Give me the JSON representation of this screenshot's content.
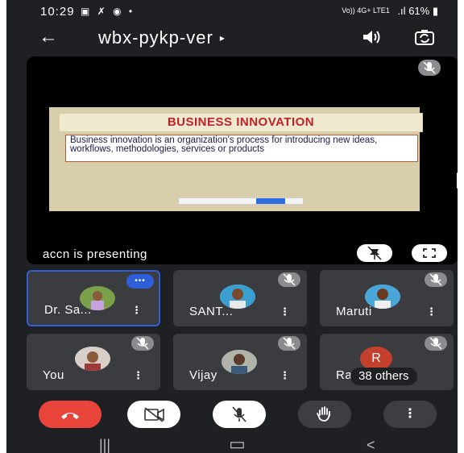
{
  "status_bar": {
    "time": "10:29",
    "notification_icons": [
      "gallery-icon",
      "missed-call-icon",
      "messenger-icon",
      "dot-icon"
    ],
    "network_label": "Vo)) 4G+ LTE1",
    "battery": "61%"
  },
  "header": {
    "meeting_title": "wbx-pykp-ver",
    "title_caret": "▸"
  },
  "presentation": {
    "slide_title": "BUSINESS INNOVATION",
    "slide_body": "Business innovation is an organization's process for introducing new ideas, workflows, methodologies, services or products",
    "presenter_label": "accn is presenting"
  },
  "participants": [
    {
      "name": "Dr. Sa...",
      "active_speaker": true,
      "muted": false
    },
    {
      "name": "SANT...",
      "active_speaker": false,
      "muted": true
    },
    {
      "name": "Maruti",
      "active_speaker": false,
      "muted": true
    },
    {
      "name": "You",
      "active_speaker": false,
      "muted": true
    },
    {
      "name": "Vijay",
      "active_speaker": false,
      "muted": true
    },
    {
      "name": "Ra",
      "avatar_initial": "R",
      "others_label": "38 others",
      "muted": true
    }
  ],
  "tile_more_glyph": "⋮",
  "speaker_badge_glyph": "•••",
  "controls": {
    "end_call": "end-call-icon",
    "video": "video-off-icon",
    "mic": "mic-off-icon",
    "hand": "raise-hand-icon",
    "more_glyph": "⋮"
  },
  "nav": {
    "recents": "|||",
    "home": "▭",
    "back": "<"
  },
  "colors": {
    "background": "#1f2023",
    "end_call": "#e8443a",
    "active_border": "#2f5fd8",
    "slide_title": "#c0202a"
  }
}
